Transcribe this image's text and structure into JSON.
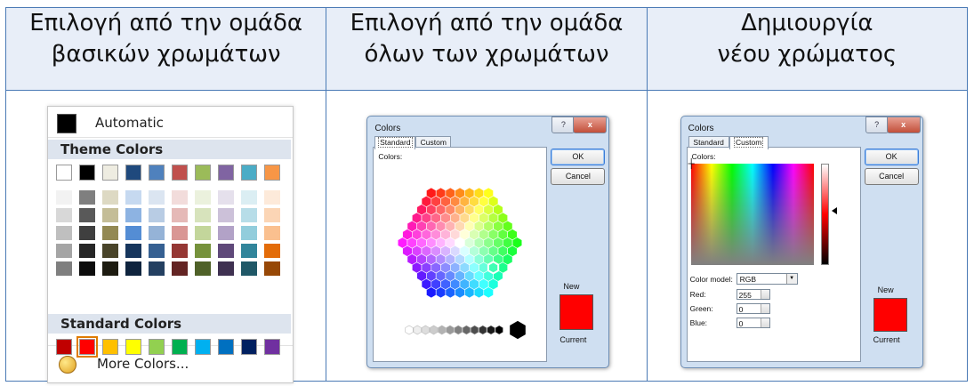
{
  "headers": [
    {
      "line1": "Επιλογή από την ομάδα",
      "line2": "βασικών χρωμάτων"
    },
    {
      "line1": "Επιλογή από την ομάδα",
      "line2": "όλων των χρωμάτων"
    },
    {
      "line1": "Δημιουργία",
      "line2": "νέου χρώματος"
    }
  ],
  "menu": {
    "automatic_label": "Automatic",
    "theme_title": "Theme Colors",
    "standard_title": "Standard Colors",
    "more_label": "More Colors...",
    "theme_colors": [
      "#ffffff",
      "#000000",
      "#eeece1",
      "#1f497d",
      "#4f81bd",
      "#c0504d",
      "#9bbb59",
      "#8064a2",
      "#4bacc6",
      "#f79646"
    ],
    "theme_tints": [
      [
        "#f2f2f2",
        "#d8d8d8",
        "#bfbfbf",
        "#a5a5a5",
        "#7f7f7f"
      ],
      [
        "#7f7f7f",
        "#595959",
        "#3f3f3f",
        "#262626",
        "#0c0c0c"
      ],
      [
        "#ddd9c3",
        "#c4bd97",
        "#938953",
        "#494429",
        "#1d1b10"
      ],
      [
        "#c6d9f0",
        "#8db3e2",
        "#548dd4",
        "#17365d",
        "#0f243e"
      ],
      [
        "#dbe5f1",
        "#b8cce4",
        "#95b3d7",
        "#366092",
        "#244061"
      ],
      [
        "#f2dcdb",
        "#e5b9b7",
        "#d99694",
        "#953734",
        "#632423"
      ],
      [
        "#ebf1dd",
        "#d7e3bc",
        "#c3d69b",
        "#76923c",
        "#4f6128"
      ],
      [
        "#e5e0ec",
        "#ccc1d9",
        "#b2a2c7",
        "#5f497a",
        "#3f3151"
      ],
      [
        "#dbeef3",
        "#b7dde8",
        "#92cddc",
        "#31859b",
        "#205867"
      ],
      [
        "#fdeada",
        "#fbd5b5",
        "#fac08f",
        "#e36c09",
        "#974806"
      ]
    ],
    "standard_colors": [
      "#c00000",
      "#ff0000",
      "#ffc000",
      "#ffff00",
      "#92d050",
      "#00b050",
      "#00b0f0",
      "#0070c0",
      "#002060",
      "#7030a0"
    ]
  },
  "dialog_standard": {
    "title": "Colors",
    "tab_standard": "Standard",
    "tab_custom": "Custom",
    "colors_label": "Colors:",
    "ok": "OK",
    "cancel": "Cancel",
    "new_label": "New",
    "current_label": "Current",
    "help_glyph": "?",
    "close_glyph": "x"
  },
  "dialog_custom": {
    "title": "Colors",
    "tab_standard": "Standard",
    "tab_custom": "Custom",
    "colors_label": "Colors:",
    "ok": "OK",
    "cancel": "Cancel",
    "color_model_label": "Color model:",
    "color_model_value": "RGB",
    "red_label": "Red:",
    "green_label": "Green:",
    "blue_label": "Blue:",
    "red_value": "255",
    "green_value": "0",
    "blue_value": "0",
    "new_label": "New",
    "current_label": "Current",
    "help_glyph": "?",
    "close_glyph": "x"
  }
}
